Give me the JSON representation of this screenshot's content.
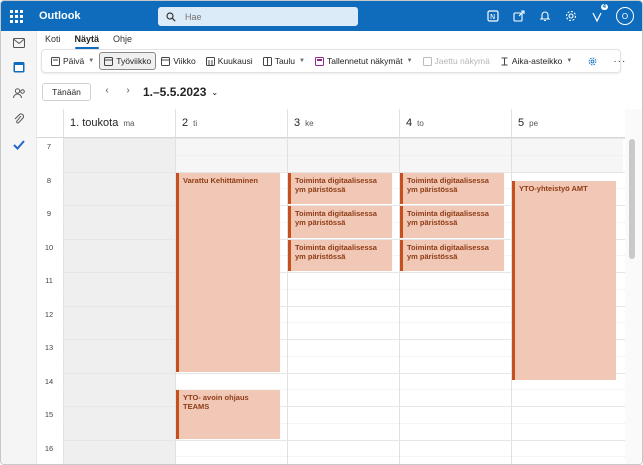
{
  "app": {
    "brand": "Outlook",
    "accent": "#0f6cbd"
  },
  "search": {
    "placeholder": "Hae",
    "value": ""
  },
  "topbar": {
    "notification_count": "4",
    "avatar_initial": "O",
    "icons": [
      "onenote-icon",
      "share-icon",
      "bell-icon",
      "gear-icon",
      "premium-icon"
    ]
  },
  "rail": {
    "items": [
      "mail-icon",
      "calendar-icon",
      "people-icon",
      "attach-icon",
      "todo-icon"
    ]
  },
  "ribbon": {
    "tabs": [
      {
        "label": "Koti",
        "active": false
      },
      {
        "label": "Näytä",
        "active": true
      },
      {
        "label": "Ohje",
        "active": false
      }
    ],
    "toolbar": {
      "day": "Päivä",
      "work_week": "Työviikko",
      "week": "Viikko",
      "month": "Kuukausi",
      "board": "Taulu",
      "saved_views": "Tallennetut näkymät",
      "save_view": "Jaettu näkymä",
      "time_scale": "Aika-asteikko"
    }
  },
  "nav": {
    "today": "Tänään",
    "range": "1.–5.5.2023"
  },
  "calendar": {
    "days": [
      {
        "num": "1. toukota",
        "name": "ma"
      },
      {
        "num": "2",
        "name": "ti"
      },
      {
        "num": "3",
        "name": "ke"
      },
      {
        "num": "4",
        "name": "to"
      },
      {
        "num": "5",
        "name": "pe"
      }
    ],
    "hours": [
      "7",
      "8",
      "9",
      "10",
      "11",
      "12",
      "13",
      "14",
      "15",
      "16"
    ],
    "events": [
      {
        "title": "Varattu Kehittäminen",
        "day": 1,
        "start": 8,
        "end": 14
      },
      {
        "title": "YTO- avoin ohjaus TEAMS",
        "day": 1,
        "start": 14.5,
        "end": 16
      },
      {
        "title": "Toiminta digitaalisessa ym päristössä",
        "day": 2,
        "start": 8,
        "end": 9
      },
      {
        "title": "Toiminta digitaalisessa ym päristössä",
        "day": 2,
        "start": 9,
        "end": 10
      },
      {
        "title": "Toiminta digitaalisessa ym päristössä",
        "day": 2,
        "start": 10,
        "end": 11
      },
      {
        "title": "Toiminta digitaalisessa ym päristössä",
        "day": 3,
        "start": 8,
        "end": 9
      },
      {
        "title": "Toiminta digitaalisessa ym päristössä",
        "day": 3,
        "start": 9,
        "end": 10
      },
      {
        "title": "Toiminta digitaalisessa ym päristössä",
        "day": 3,
        "start": 10,
        "end": 11
      },
      {
        "title": "YTO-yhteistyö AMT",
        "day": 4,
        "start": 8.25,
        "end": 14.25
      }
    ],
    "event_color": "#f1c8b6",
    "event_border": "#c4501e"
  }
}
